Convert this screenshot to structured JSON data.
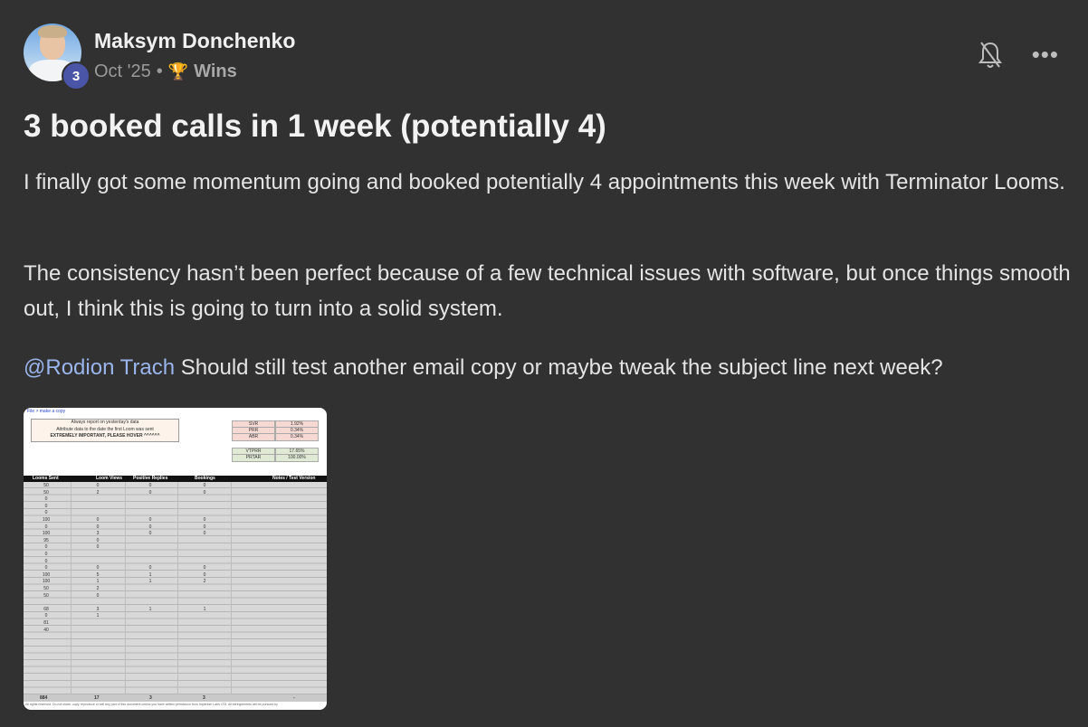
{
  "post": {
    "author": "Maksym Donchenko",
    "level": "3",
    "date": "Oct '25",
    "separator": "•",
    "category": "Wins",
    "title": "3 booked calls in 1 week (potentially 4)",
    "paragraph1": "I finally got some momentum going and booked potentially 4 appointments this week with Terminator Looms.",
    "paragraph2": "The consistency hasn’t been perfect because of a few technical issues with software, but once things smooth out, I think this is going to turn into a solid system.",
    "mention": "@Rodion Trach",
    "paragraph3": " Should still test another email copy or maybe tweak the subject line next week?"
  },
  "icons": {
    "bell": "bell-off-icon",
    "more": "more-horizontal-icon",
    "trophy": "trophy-icon"
  },
  "sheet": {
    "link": "File > make a copy",
    "notes": [
      "Always report on yesterday's data",
      "Attribute data to the date the first Loom was sent",
      "EXTREMELY IMPORTANT, PLEASE HOVER ^^^^^^"
    ],
    "metrics_a": [
      [
        "SVR",
        "1.92%"
      ],
      [
        "PRR",
        "0.34%"
      ],
      [
        "ABR",
        "0.34%"
      ]
    ],
    "metrics_b": [
      [
        "VTPRR",
        "17.65%"
      ],
      [
        "PRTAR",
        "100.00%"
      ]
    ],
    "headers": [
      "Looms Sent",
      "Loom Views",
      "Positive Replies",
      "Bookings",
      "Notes / Test Version"
    ],
    "rows": [
      [
        "50",
        "0",
        "0",
        "0"
      ],
      [
        "50",
        "2",
        "0",
        "0"
      ],
      [
        "0",
        "",
        "",
        ""
      ],
      [
        "0",
        "",
        "",
        ""
      ],
      [
        "0",
        "",
        "",
        ""
      ],
      [
        "100",
        "0",
        "0",
        "0"
      ],
      [
        "0",
        "0",
        "0",
        "0"
      ],
      [
        "100",
        "3",
        "0",
        "0"
      ],
      [
        "95",
        "0",
        "",
        ""
      ],
      [
        "0",
        "0",
        "",
        ""
      ],
      [
        "0",
        "",
        "",
        ""
      ],
      [
        "0",
        "",
        "",
        ""
      ],
      [
        "0",
        "0",
        "0",
        "0"
      ],
      [
        "100",
        "5",
        "1",
        "0"
      ],
      [
        "100",
        "1",
        "1",
        "2"
      ],
      [
        "50",
        "2",
        "",
        ""
      ],
      [
        "50",
        "0",
        "",
        ""
      ],
      [
        "",
        "",
        "",
        ""
      ],
      [
        "68",
        "3",
        "1",
        "1"
      ],
      [
        "0",
        "1",
        "",
        ""
      ],
      [
        "81",
        "",
        "",
        ""
      ],
      [
        "40",
        "",
        "",
        ""
      ]
    ],
    "totals": [
      "884",
      "17",
      "3",
      "3",
      "-"
    ],
    "footer": "All rights reserved. Do not share, copy, reproduce or sell any part of this document unless you have written permission from Imperium Labs LTD. All infringements will be pursued by"
  }
}
